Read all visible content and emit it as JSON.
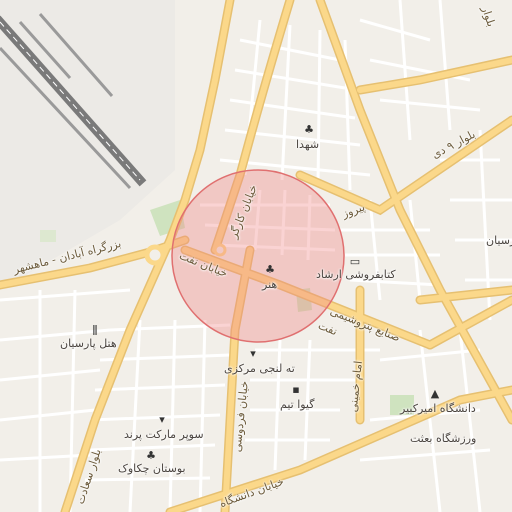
{
  "map": {
    "labels": {
      "shohada": "شهدا",
      "honar": "هنر",
      "ketabforoushi": "کتابفروشی ارشاد",
      "hotel": "هتل پارسیان",
      "talanji": "ته لنجی مرکزی",
      "giva": "گیوا تیم",
      "amirkabir": "دانشگاه امیرکبیر",
      "varzeshgah": "ورزشگاه بعثت",
      "supermarket": "سوپر مارکت پرند",
      "bustan": "بوستان چکاوک",
      "parsian_right": "پارسیان",
      "sanaye": "صنایع پتروشیمی"
    },
    "roads": {
      "azadegan": "بزرگراه آبادان - ماهشهر",
      "karg": "خیابان کارگر",
      "naft_w": "خیابان نفت",
      "naft_e": "نفت",
      "pirouz": "پیروز",
      "bolvar_deh": "بلوار ۹ دی",
      "ferdowsi": "خیابان فردوسی",
      "daneshgah": "خیابان دانشگاه",
      "saadat": "بلوار سعادت",
      "imam": "امام خمینی",
      "ab": "بلوار"
    },
    "highlight_color": "#f08080"
  }
}
